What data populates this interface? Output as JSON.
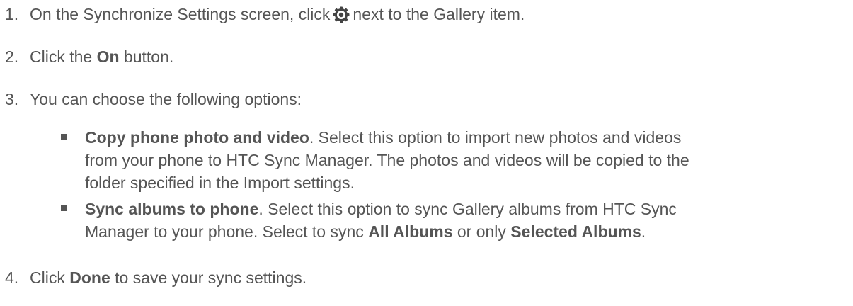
{
  "steps": [
    {
      "number": "1.",
      "text_before": "On the Synchronize Settings screen, click",
      "icon": "gear-icon",
      "text_after": "next to the Gallery item."
    },
    {
      "number": "2.",
      "text_before": "Click the ",
      "bold": "On",
      "text_after": " button."
    },
    {
      "number": "3.",
      "text": "You can choose the following options:"
    },
    {
      "number": "4.",
      "text_before": "Click ",
      "bold": "Done",
      "text_after": " to save your sync settings."
    }
  ],
  "options": [
    {
      "title": "Copy phone photo and video",
      "line1": ". Select this option to import new photos and videos",
      "line2": "from your phone to HTC Sync Manager. The photos and videos will be copied to the",
      "line3": "folder specified in the Import settings."
    },
    {
      "title": "Sync albums to phone",
      "line1": ". Select this option to sync Gallery albums from HTC Sync",
      "line2_before": "Manager to your phone. Select to sync ",
      "bold_a": "All Albums",
      "line2_mid": " or only ",
      "bold_b": "Selected Albums",
      "line2_end": "."
    }
  ]
}
